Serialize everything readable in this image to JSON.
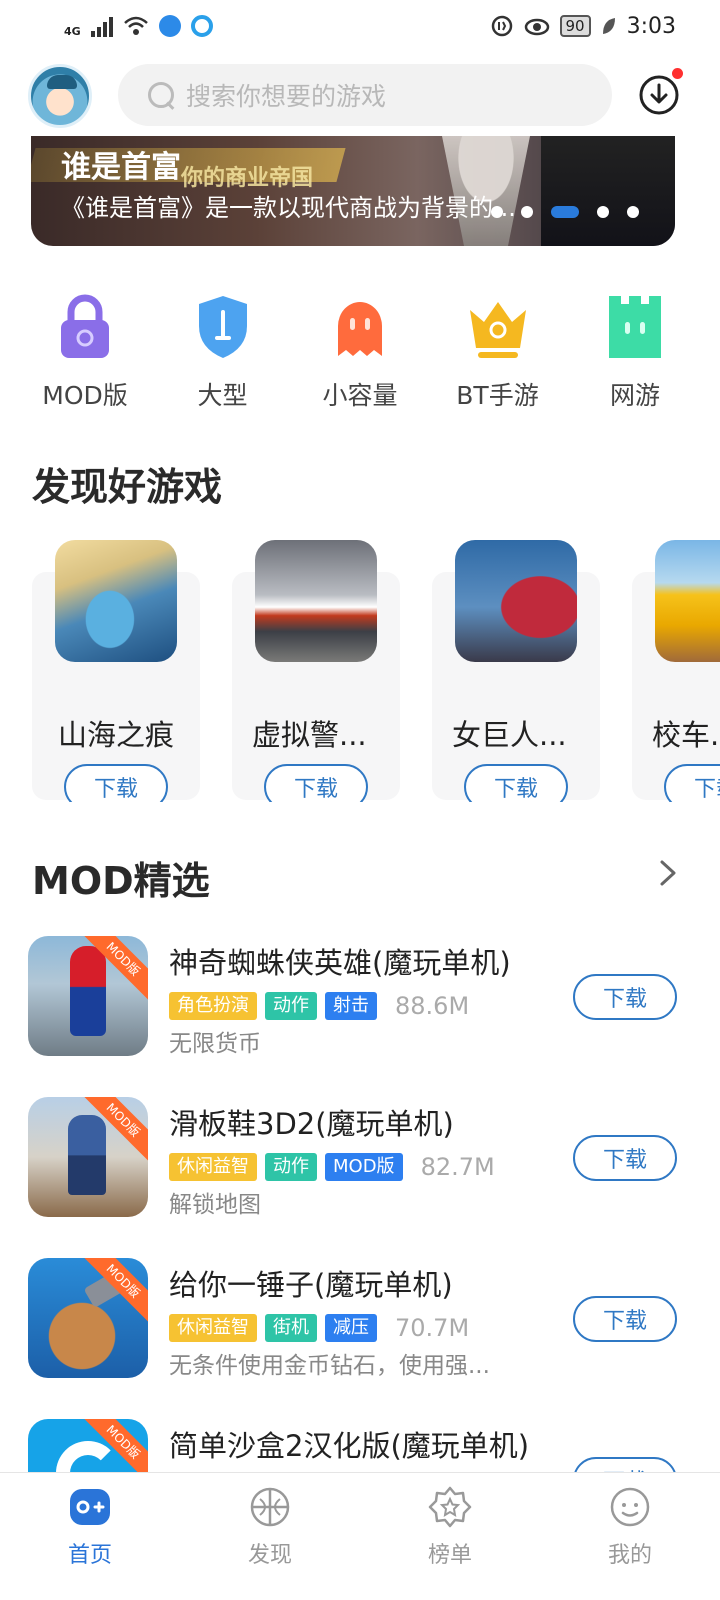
{
  "status_bar": {
    "network": "4G",
    "battery": "90",
    "time": "3:03"
  },
  "header": {
    "search_placeholder": "搜索你想要的游戏"
  },
  "banner": {
    "title": "谁是首富",
    "subtitle": "你的商业帝国",
    "description": "《谁是首富》是一款以现代商战为背景的...",
    "slide_count": 5,
    "active_slide": 3
  },
  "categories": [
    {
      "label": "MOD版",
      "icon": "lock-icon",
      "color": "#8a6ee8"
    },
    {
      "label": "大型",
      "icon": "shield-icon",
      "color": "#4da3f0"
    },
    {
      "label": "小容量",
      "icon": "ghost-icon",
      "color": "#ff6b3d"
    },
    {
      "label": "BT手游",
      "icon": "crown-icon",
      "color": "#f5b820"
    },
    {
      "label": "网游",
      "icon": "castle-icon",
      "color": "#3ddca6"
    }
  ],
  "discover": {
    "title": "发现好游戏",
    "download_label": "下载",
    "games": [
      {
        "name": "山海之痕"
      },
      {
        "name": "虚拟警..."
      },
      {
        "name": "女巨人..."
      },
      {
        "name": "校车..."
      }
    ]
  },
  "mod_section": {
    "title": "MOD精选",
    "download_label": "下载",
    "ribbon": "MOD版",
    "items": [
      {
        "title": "神奇蜘蛛侠英雄(魔玩单机)",
        "tags": [
          "角色扮演",
          "动作",
          "射击"
        ],
        "size": "88.6M",
        "desc": "无限货币"
      },
      {
        "title": "滑板鞋3D2(魔玩单机)",
        "tags": [
          "休闲益智",
          "动作",
          "MOD版"
        ],
        "size": "82.7M",
        "desc": "解锁地图"
      },
      {
        "title": "给你一锤子(魔玩单机)",
        "tags": [
          "休闲益智",
          "街机",
          "减压"
        ],
        "size": "70.7M",
        "desc": "无条件使用金币钻石，使用强..."
      },
      {
        "title": "简单沙盒2汉化版(魔玩单机)",
        "tags": [],
        "size": "",
        "desc": ""
      }
    ]
  },
  "bottom_nav": [
    {
      "label": "首页",
      "active": true
    },
    {
      "label": "发现",
      "active": false
    },
    {
      "label": "榜单",
      "active": false
    },
    {
      "label": "我的",
      "active": false
    }
  ]
}
